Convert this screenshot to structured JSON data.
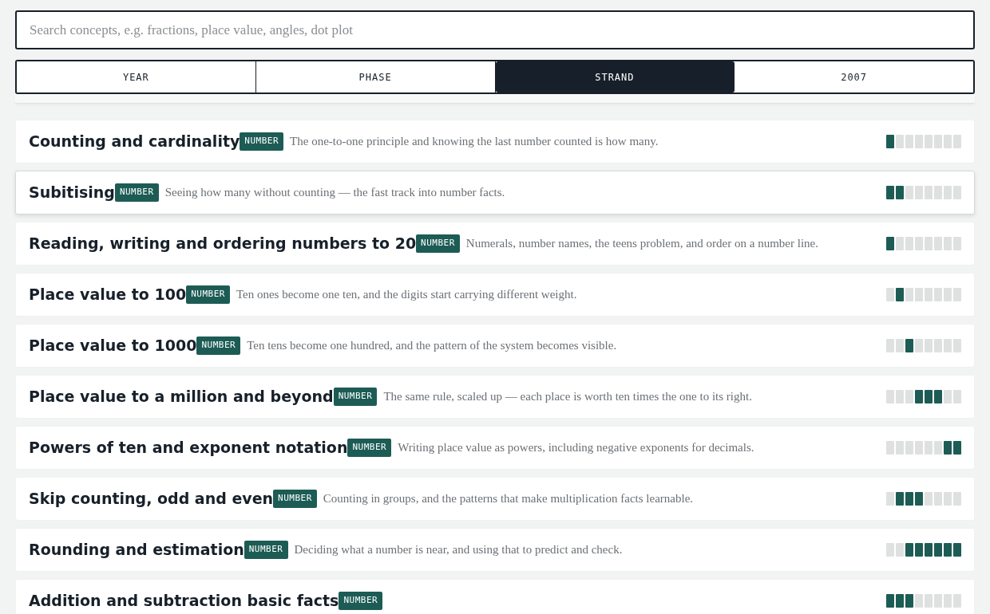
{
  "search": {
    "placeholder": "Search concepts, e.g. fractions, place value, angles, dot plot"
  },
  "tabs": [
    {
      "label": "YEAR",
      "selected": false
    },
    {
      "label": "PHASE",
      "selected": false
    },
    {
      "label": "STRAND",
      "selected": true
    },
    {
      "label": "2007",
      "selected": false
    }
  ],
  "concepts": [
    {
      "title": "Counting and cardinality",
      "badge": "NUMBER",
      "description": "The one-to-one principle and knowing the last number counted is how many.",
      "selected": false,
      "segments": [
        {
          "filled": true
        },
        {
          "filled": false
        },
        {
          "filled": false
        },
        {
          "filled": false
        },
        {
          "filled": false
        },
        {
          "filled": false
        },
        {
          "filled": false
        },
        {
          "filled": false
        }
      ]
    },
    {
      "title": "Subitising",
      "badge": "NUMBER",
      "description": "Seeing how many without counting — the fast track into number facts.",
      "selected": true,
      "segments": [
        {
          "filled": true
        },
        {
          "filled": true
        },
        {
          "filled": false
        },
        {
          "filled": false
        },
        {
          "filled": false
        },
        {
          "filled": false
        },
        {
          "filled": false
        },
        {
          "filled": false
        }
      ]
    },
    {
      "title": "Reading, writing and ordering numbers to 20",
      "badge": "NUMBER",
      "description": "Numerals, number names, the teens problem, and order on a number line.",
      "selected": false,
      "segments": [
        {
          "filled": true
        },
        {
          "filled": false
        },
        {
          "filled": false
        },
        {
          "filled": false
        },
        {
          "filled": false
        },
        {
          "filled": false
        },
        {
          "filled": false
        },
        {
          "filled": false
        }
      ]
    },
    {
      "title": "Place value to 100",
      "badge": "NUMBER",
      "description": "Ten ones become one ten, and the digits start carrying different weight.",
      "selected": false,
      "segments": [
        {
          "filled": false
        },
        {
          "filled": true
        },
        {
          "filled": false
        },
        {
          "filled": false
        },
        {
          "filled": false
        },
        {
          "filled": false
        },
        {
          "filled": false
        },
        {
          "filled": false
        }
      ]
    },
    {
      "title": "Place value to 1000",
      "badge": "NUMBER",
      "description": "Ten tens become one hundred, and the pattern of the system becomes visible.",
      "selected": false,
      "segments": [
        {
          "filled": false
        },
        {
          "filled": false
        },
        {
          "filled": true
        },
        {
          "filled": false
        },
        {
          "filled": false
        },
        {
          "filled": false
        },
        {
          "filled": false
        },
        {
          "filled": false
        }
      ]
    },
    {
      "title": "Place value to a million and beyond",
      "badge": "NUMBER",
      "description": "The same rule, scaled up — each place is worth ten times the one to its right.",
      "selected": false,
      "segments": [
        {
          "filled": false
        },
        {
          "filled": false
        },
        {
          "filled": false
        },
        {
          "filled": true
        },
        {
          "filled": true
        },
        {
          "filled": true
        },
        {
          "filled": false
        },
        {
          "filled": false
        }
      ]
    },
    {
      "title": "Powers of ten and exponent notation",
      "badge": "NUMBER",
      "description": "Writing place value as powers, including negative exponents for decimals.",
      "selected": false,
      "segments": [
        {
          "filled": false
        },
        {
          "filled": false
        },
        {
          "filled": false
        },
        {
          "filled": false
        },
        {
          "filled": false
        },
        {
          "filled": false
        },
        {
          "filled": true
        },
        {
          "filled": true
        }
      ]
    },
    {
      "title": "Skip counting, odd and even",
      "badge": "NUMBER",
      "description": "Counting in groups, and the patterns that make multiplication facts learnable.",
      "selected": false,
      "segments": [
        {
          "filled": false
        },
        {
          "filled": true
        },
        {
          "filled": true
        },
        {
          "filled": true
        },
        {
          "filled": false
        },
        {
          "filled": false
        },
        {
          "filled": false
        },
        {
          "filled": false
        }
      ]
    },
    {
      "title": "Rounding and estimation",
      "badge": "NUMBER",
      "description": "Deciding what a number is near, and using that to predict and check.",
      "selected": false,
      "segments": [
        {
          "filled": false
        },
        {
          "filled": false
        },
        {
          "filled": true
        },
        {
          "filled": true
        },
        {
          "filled": true
        },
        {
          "filled": true
        },
        {
          "filled": true
        },
        {
          "filled": true
        }
      ]
    },
    {
      "title": "Addition and subtraction basic facts",
      "badge": "NUMBER",
      "selected": false,
      "segments": [
        {
          "filled": true
        },
        {
          "filled": true
        },
        {
          "filled": true
        },
        {
          "filled": false
        },
        {
          "filled": false
        },
        {
          "filled": false
        },
        {
          "filled": false
        },
        {
          "filled": false
        }
      ]
    }
  ]
}
